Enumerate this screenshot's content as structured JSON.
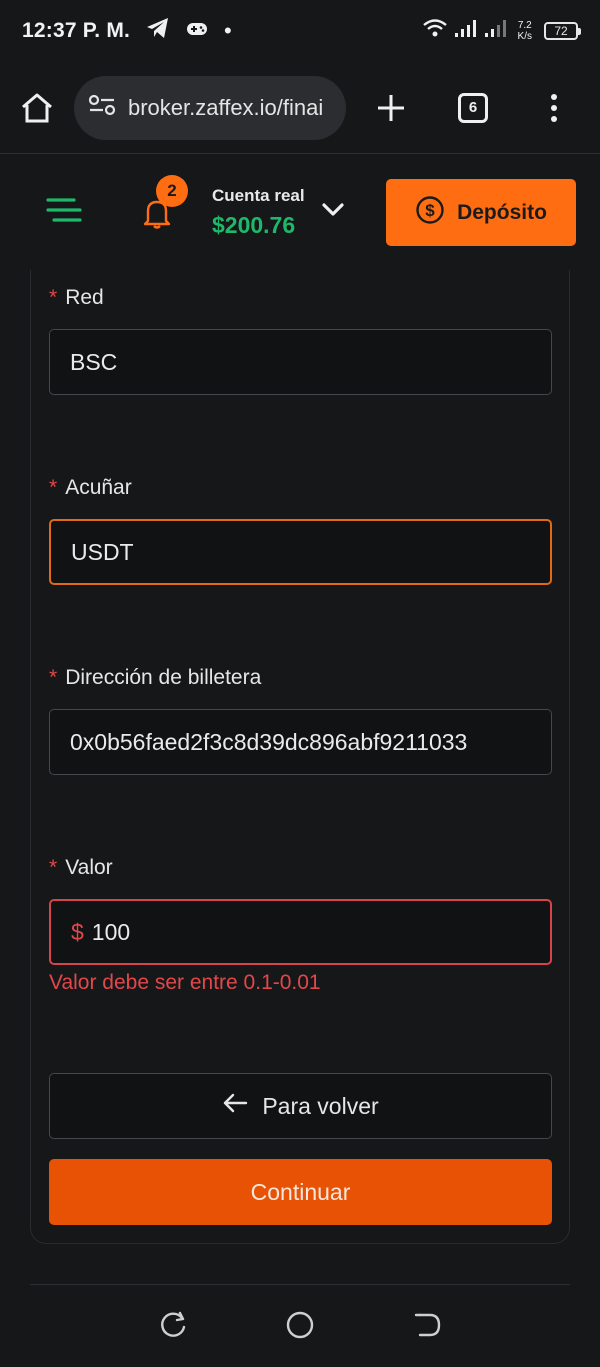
{
  "status_bar": {
    "time": "12:37 P. M.",
    "net_speed_value": "7.2",
    "net_speed_unit": "K/s",
    "battery": "72"
  },
  "browser": {
    "url": "broker.zaffex.io/finai",
    "tab_count": "6"
  },
  "header": {
    "notification_count": "2",
    "account_type": "Cuenta real",
    "balance": "$200.76",
    "deposit_label": "Depósito"
  },
  "form": {
    "network": {
      "label": "Red",
      "value": "BSC"
    },
    "coin": {
      "label": "Acuñar",
      "value": "USDT"
    },
    "wallet": {
      "label": "Dirección de billetera",
      "value": "0x0b56faed2f3c8d39dc896abf9211033"
    },
    "amount": {
      "label": "Valor",
      "currency": "$",
      "value": "100",
      "error": "Valor debe ser entre 0.1-0.01"
    },
    "back_label": "Para volver",
    "continue_label": "Continuar"
  },
  "colors": {
    "accent": "#ff6d12",
    "balance": "#1fb86a",
    "error": "#e2474a",
    "continue": "#e85205"
  }
}
